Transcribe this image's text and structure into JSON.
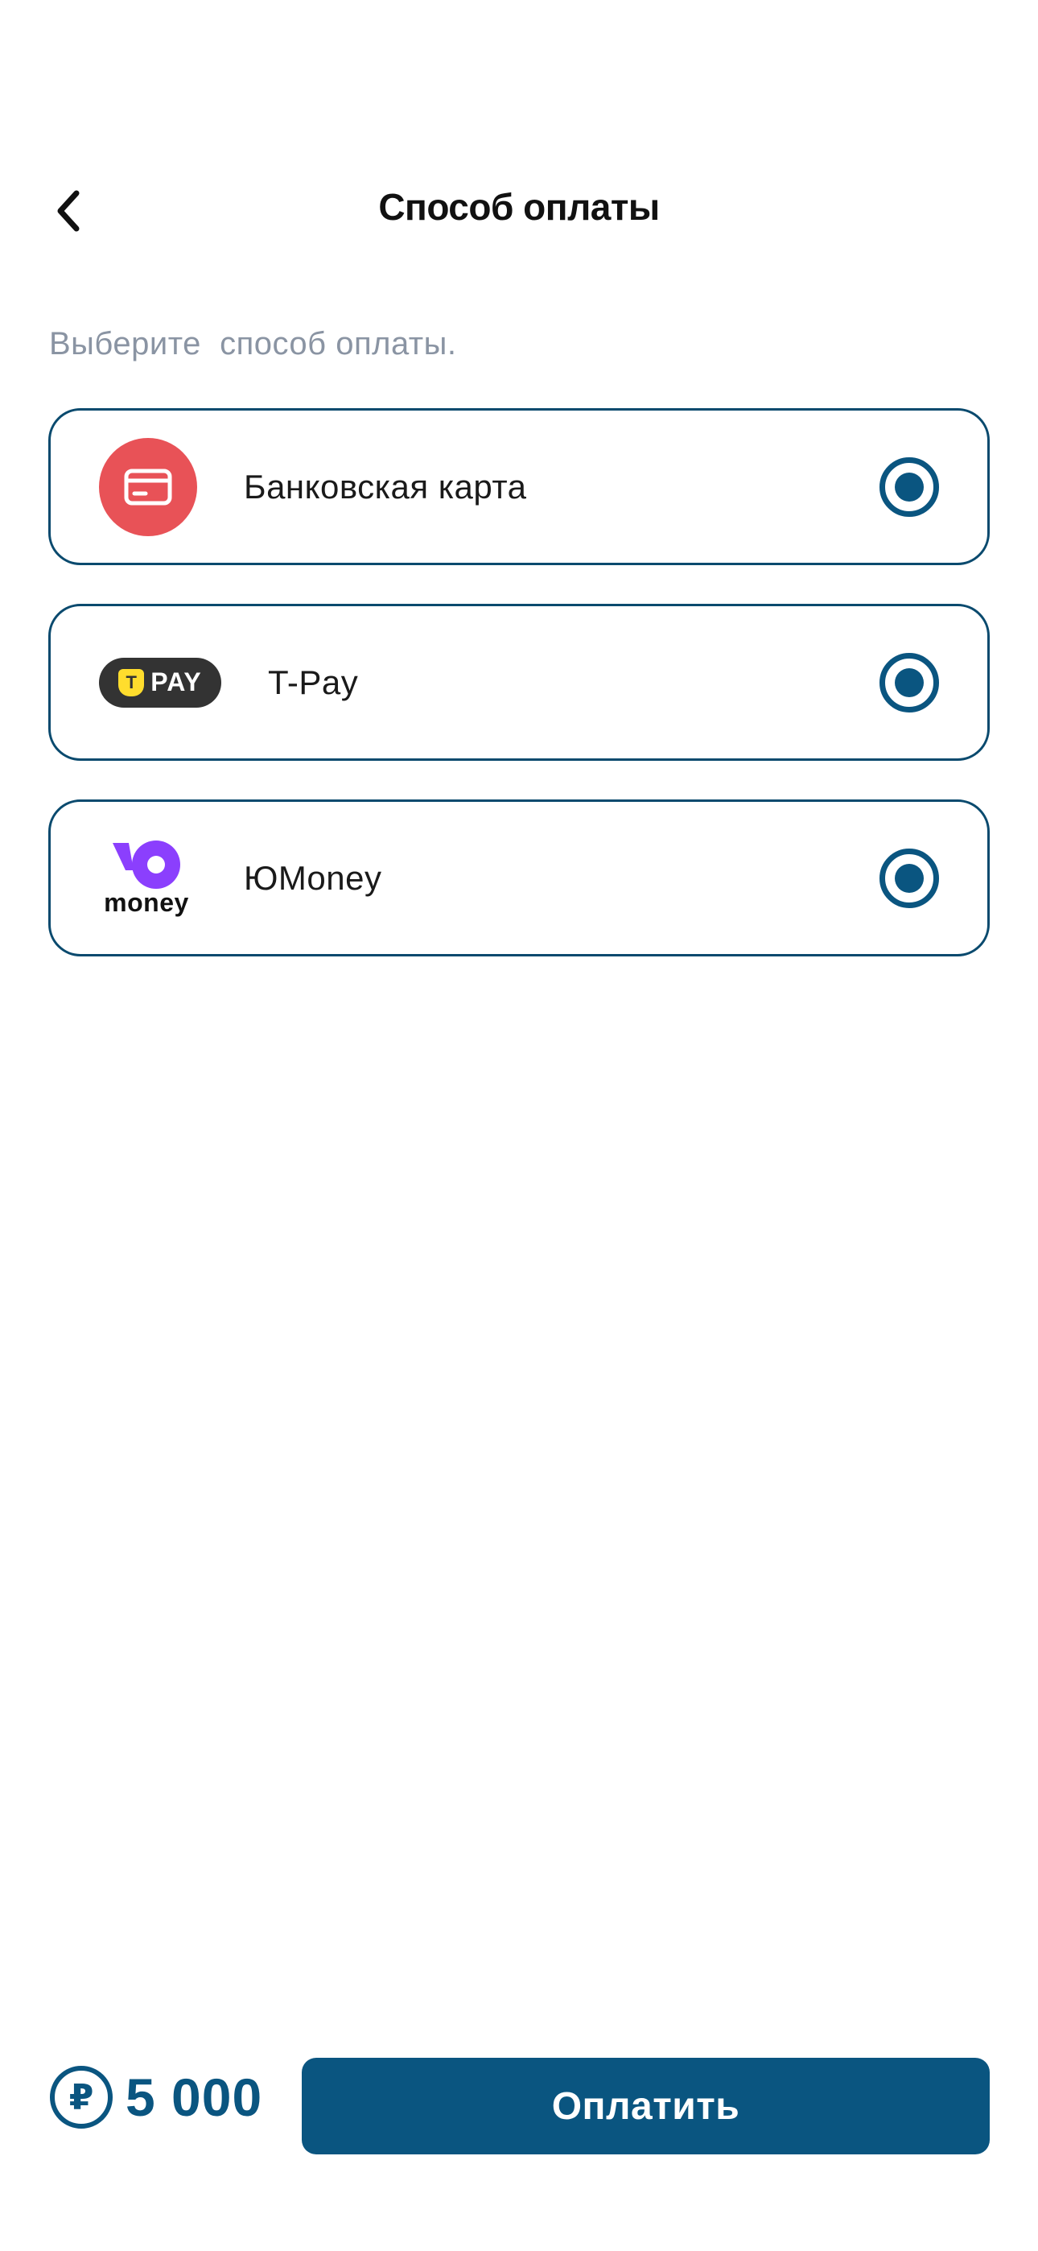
{
  "header": {
    "title": "Способ оплаты",
    "back_icon": "chevron-left-icon"
  },
  "subtitle": "Выберите  способ оплаты.",
  "payment_methods": [
    {
      "label": "Банковская карта",
      "icon": "credit-card-icon",
      "icon_color": "#e85257",
      "selected": true
    },
    {
      "label": "T-Pay",
      "icon": "tpay-logo",
      "logo_text": "PAY",
      "logo_mark": "T",
      "icon_color": "#333333",
      "accent_color": "#ffdd2d",
      "selected": true
    },
    {
      "label": "ЮMoney",
      "icon": "yoomoney-logo",
      "logo_text": "money",
      "icon_color": "#8b3ffd",
      "selected": true
    }
  ],
  "footer": {
    "price": "5 000",
    "currency_icon": "ruble-icon",
    "currency_symbol": "₽",
    "pay_button_label": "Оплатить"
  },
  "colors": {
    "primary": "#0a5580",
    "border": "#0a4a6e",
    "subtitle": "#8a94a3",
    "background": "#ffffff"
  }
}
